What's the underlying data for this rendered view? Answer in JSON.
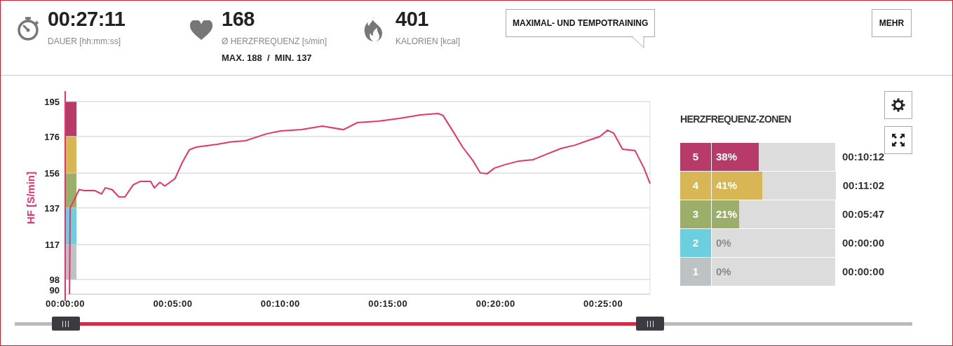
{
  "stats": [
    {
      "kind": "duration",
      "value": "00:27:11",
      "label": "DAUER [hh:mm:ss]"
    },
    {
      "kind": "heart_rate",
      "value": "168",
      "label": "Ø HERZFREQUENZ [s/min]",
      "extra": "MAX. 188  /  MIN. 137"
    },
    {
      "kind": "calories",
      "value": "401",
      "label": "KALORIEN [kcal]"
    }
  ],
  "training_type_button": "MAXIMAL- UND TEMPOTRAINING",
  "more_button": "MEHR",
  "chart": {
    "chart_data": {
      "type": "line",
      "ylabel": "HF [S/min]",
      "x": [
        0.2,
        0.23,
        0.65,
        0.88,
        1.37,
        1.69,
        1.86,
        2.18,
        2.5,
        2.77,
        3.16,
        3.49,
        3.97,
        4.14,
        4.4,
        4.63,
        5.1,
        5.44,
        5.77,
        6.09,
        7.07,
        7.72,
        8.37,
        9.35,
        10.0,
        10.98,
        11.95,
        12.93,
        13.58,
        14.56,
        15.54,
        16.52,
        17.33,
        17.56,
        17.99,
        18.47,
        18.96,
        19.29,
        19.62,
        19.94,
        20.43,
        21.09,
        21.74,
        22.39,
        23.04,
        23.7,
        24.35,
        24.84,
        25.2,
        25.49,
        25.9,
        26.48,
        26.9,
        27.18
      ],
      "series": [
        {
          "color": "#e8336b",
          "values": [
            90,
            137,
            147,
            146.5,
            146.5,
            144.6,
            148,
            147,
            143,
            143,
            149.6,
            151.5,
            151.5,
            148,
            151,
            149,
            153,
            161.8,
            168.7,
            170.2,
            171.7,
            173,
            173.6,
            177.4,
            179,
            179.7,
            181.6,
            179.7,
            183.5,
            184.3,
            185.8,
            187.7,
            188.5,
            187.4,
            179.4,
            170.2,
            162.6,
            156.1,
            155.7,
            158.7,
            160.6,
            162.6,
            163.3,
            166.4,
            169.4,
            171.3,
            174,
            175.9,
            179.4,
            177.8,
            169,
            168.3,
            158.7,
            150.3
          ]
        }
      ],
      "xlim": [
        0,
        27.18
      ],
      "ylim": [
        90,
        195
      ],
      "xticks": [
        {
          "value": 0,
          "label": "00:00:00"
        },
        {
          "value": 5,
          "label": "00:05:00"
        },
        {
          "value": 10,
          "label": "00:10:00"
        },
        {
          "value": 15,
          "label": "00:15:00"
        },
        {
          "value": 20,
          "label": "00:20:00"
        },
        {
          "value": 25,
          "label": "00:25:00"
        }
      ],
      "yticks": [
        90,
        98,
        117,
        137,
        156,
        176,
        195
      ],
      "grid": true
    }
  },
  "zones_panel": {
    "title": "HERZFREQUENZ-ZONEN",
    "zones": [
      {
        "number": "5",
        "percent": "38%",
        "time": "00:10:12",
        "color": "#b83a68",
        "level": 0.38
      },
      {
        "number": "4",
        "percent": "41%",
        "time": "00:11:02",
        "color": "#d8b655",
        "level": 0.41
      },
      {
        "number": "3",
        "percent": "21%",
        "time": "00:05:47",
        "color": "#9caf6a",
        "level": 0.22
      },
      {
        "number": "2",
        "percent": "0%",
        "time": "00:00:00",
        "color": "#6ccfe0",
        "level": 0
      },
      {
        "number": "1",
        "percent": "0%",
        "time": "00:00:00",
        "color": "#bdc3c5",
        "level": 0
      }
    ]
  }
}
